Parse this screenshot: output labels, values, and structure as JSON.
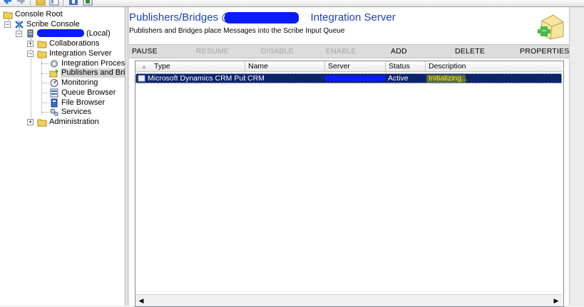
{
  "toolbar": {
    "buttons": [
      "back-arrow",
      "forward-arrow",
      "up-folder",
      "show-tree",
      "properties",
      "help"
    ]
  },
  "tree": {
    "items": [
      {
        "label": "Console Root",
        "icon": "folder-icon"
      },
      {
        "label": "Scribe Console",
        "icon": "scribe-icon",
        "expander": "−"
      },
      {
        "label": "(Local)",
        "icon": "server-icon",
        "expander": "−"
      },
      {
        "label": "Collaborations",
        "icon": "folder-icon",
        "expander": "+"
      },
      {
        "label": "Integration Server",
        "icon": "folder-icon",
        "expander": "−"
      },
      {
        "label": "Integration Processes",
        "icon": "gear-icon"
      },
      {
        "label": "Publishers and Bridges",
        "icon": "publisher-icon",
        "selected": true
      },
      {
        "label": "Monitoring",
        "icon": "monitor-icon"
      },
      {
        "label": "Queue Browser",
        "icon": "queue-icon"
      },
      {
        "label": "File Browser",
        "icon": "file-icon"
      },
      {
        "label": "Services",
        "icon": "services-icon"
      },
      {
        "label": "Administration",
        "icon": "folder-icon",
        "expander": "+"
      }
    ]
  },
  "header": {
    "title_prefix": "Publishers/Bridges @",
    "title_suffix": "Integration Server",
    "subtitle": "Publishers and Bridges place Messages into the Scribe Input Queue"
  },
  "actions": [
    {
      "label": "PAUSE",
      "enabled": true
    },
    {
      "label": "RESUME",
      "enabled": false
    },
    {
      "label": "DISABLE",
      "enabled": false
    },
    {
      "label": "ENABLE",
      "enabled": false
    },
    {
      "label": "ADD",
      "enabled": true
    },
    {
      "label": "DELETE",
      "enabled": true
    },
    {
      "label": "PROPERTIES",
      "enabled": true
    }
  ],
  "table": {
    "columns": [
      "Type",
      "Name",
      "Server",
      "Status",
      "Description"
    ],
    "rows": [
      {
        "type": "Microsoft Dynamics CRM Publi...",
        "name": "CRM",
        "server": "",
        "status": "Active",
        "description": "Initializing..."
      }
    ]
  },
  "colors": {
    "title": "#1f3fc4",
    "selection": "#0b246a",
    "highlight": "#f4f000",
    "redaction": "#0a1bff"
  }
}
